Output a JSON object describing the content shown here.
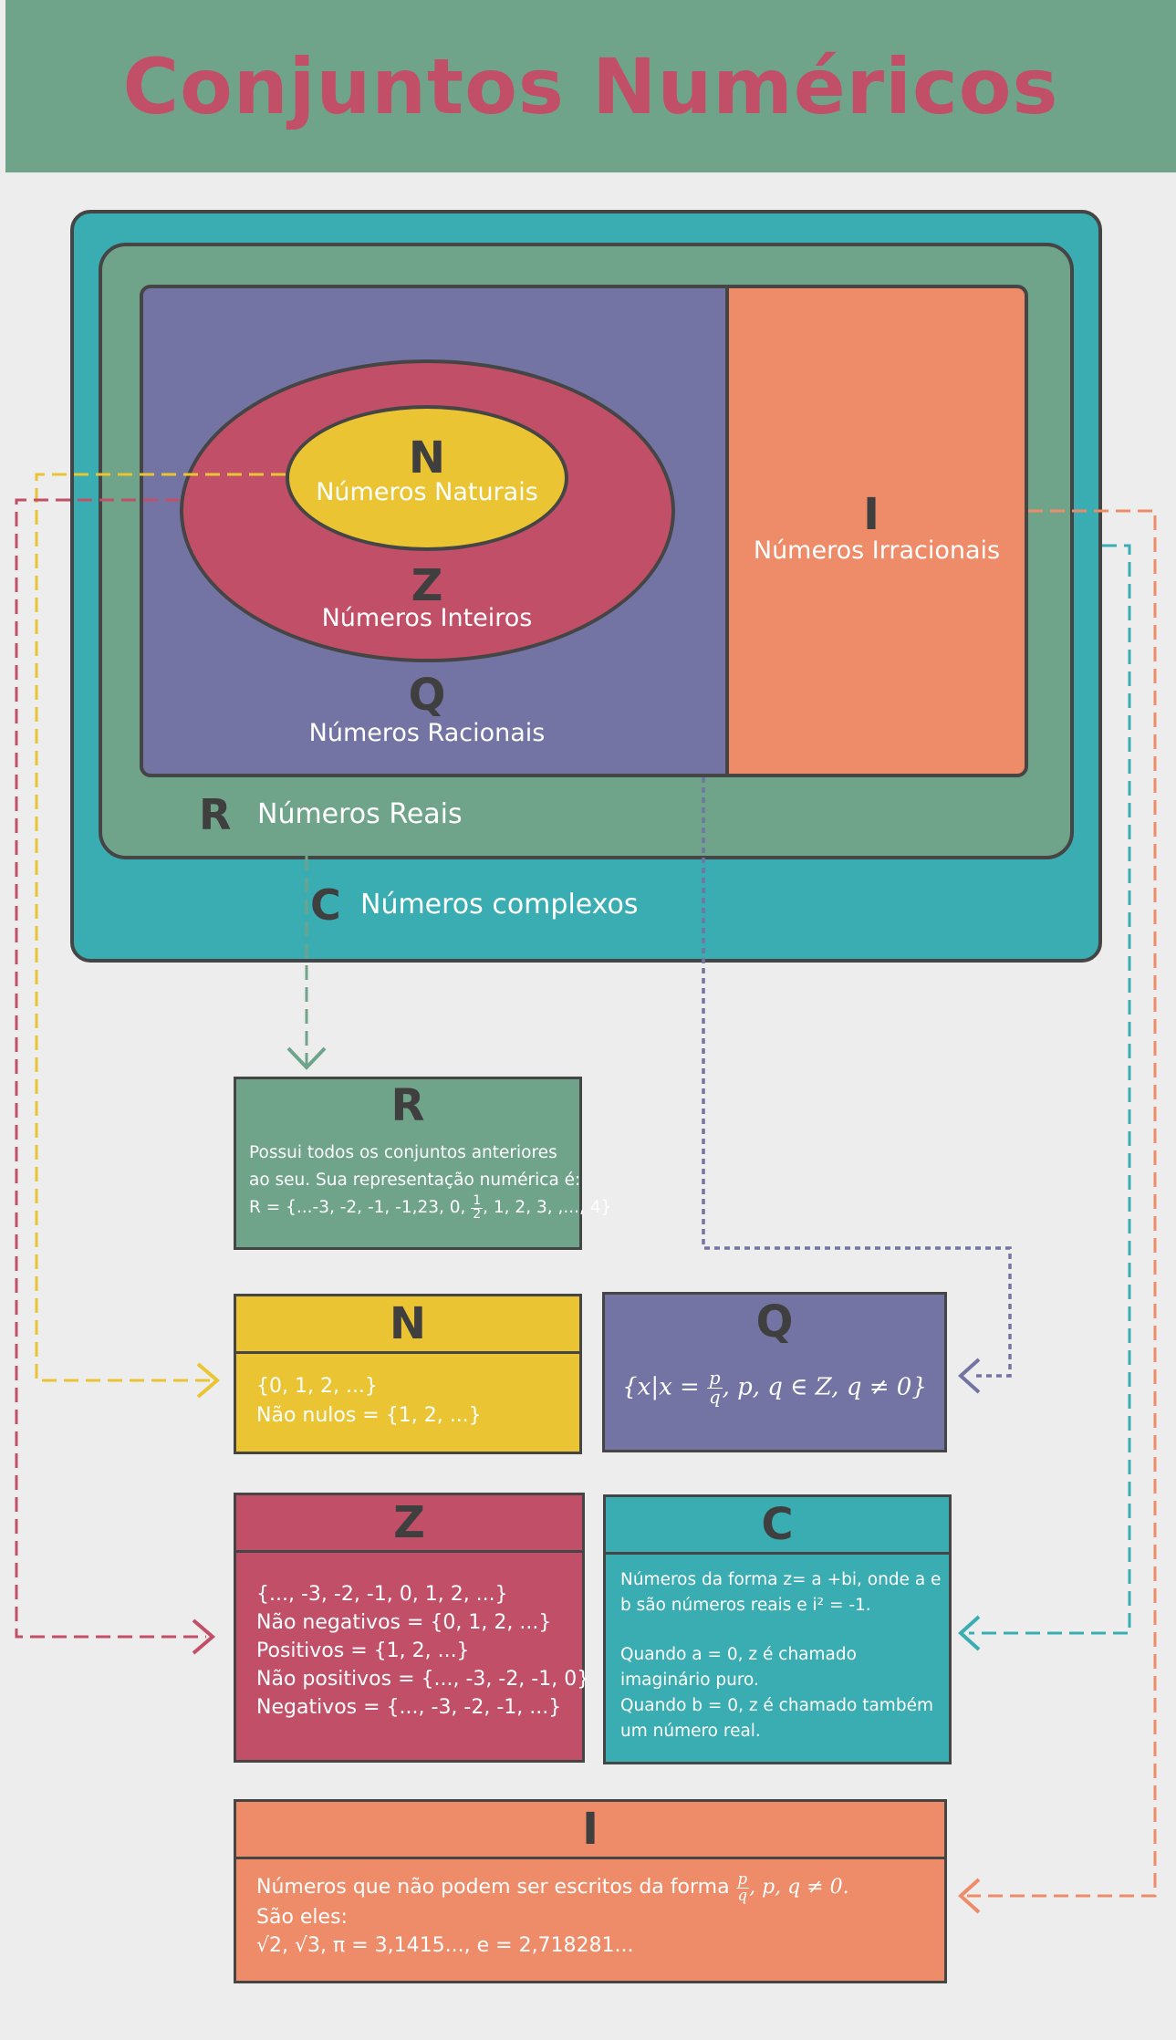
{
  "title": "Conjuntos Numéricos",
  "colors": {
    "header_bg": "#6fa48b",
    "title": "#c24f68",
    "complex": "#3aadb2",
    "real": "#6fa48b",
    "rational": "#7374a3",
    "irrational": "#ee8b69",
    "integer": "#c24f68",
    "natural": "#ebc433",
    "background": "#ededed"
  },
  "diagram": {
    "N": {
      "letter": "N",
      "label": "Números Naturais"
    },
    "Z": {
      "letter": "Z",
      "label": "Números Inteiros"
    },
    "Q": {
      "letter": "Q",
      "label": "Números Racionais"
    },
    "I": {
      "letter": "I",
      "label": "Números Irracionais"
    },
    "R": {
      "letter": "R",
      "label": "Números Reais"
    },
    "C": {
      "letter": "C",
      "label": "Números complexos"
    }
  },
  "cards": {
    "R": {
      "letter": "R",
      "line1": "Possui todos os conjuntos anteriores",
      "line2": "ao seu. Sua representação numérica é:",
      "line3_prefix": "R = {...-3, -2, -1, -1,23, 0, ",
      "frac_num": "1",
      "frac_den": "2",
      "line3_suffix": ", 1, 2, 3, ,..., 4}"
    },
    "N": {
      "letter": "N",
      "line1": "{0, 1, 2, ...}",
      "line2": "Não nulos = {1, 2, ...}"
    },
    "Q": {
      "letter": "Q",
      "formula_prefix": "{x|x = ",
      "frac_num": "p",
      "frac_den": "q",
      "formula_suffix": ", p, q  ∈ Z, q ≠ 0}"
    },
    "Z": {
      "letter": "Z",
      "lines": [
        "{..., -3, -2, -1, 0, 1, 2, ...}",
        "Não negativos = {0, 1, 2, ...}",
        "Positivos = {1, 2, ...}",
        "Não positivos = {..., -3, -2, -1, 0}",
        "Negativos = {..., -3, -2, -1, ...}"
      ]
    },
    "C": {
      "letter": "C",
      "line1": "Números da forma z= a +bi, onde a e",
      "line2": "b são números reais e i² = -1.",
      "line3": "Quando a = 0, z é chamado",
      "line4": "imaginário puro.",
      "line5": "Quando b = 0, z é chamado também",
      "line6": "um número real."
    },
    "I": {
      "letter": "I",
      "line1_prefix": "Números que não podem ser escritos da forma ",
      "frac_num": "p",
      "frac_den": "q",
      "line1_suffix": ", p, q ≠ 0.",
      "line2": "São eles:",
      "line3": "√2, √3, π = 3,1415..., e = 2,718281..."
    }
  }
}
